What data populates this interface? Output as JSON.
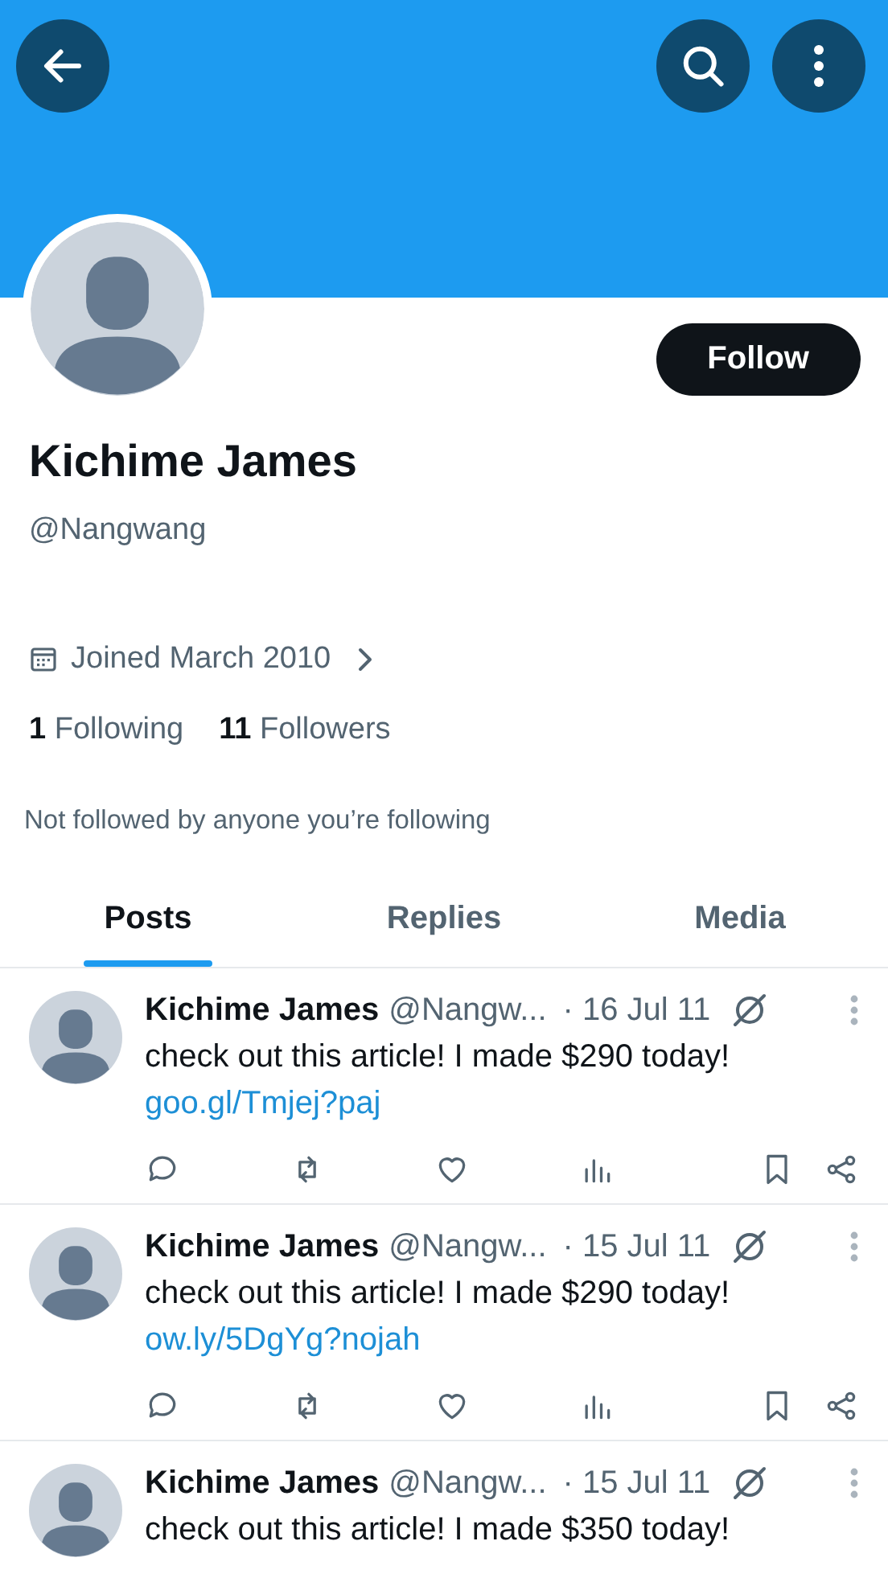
{
  "profile": {
    "name": "Kichime James",
    "handle": "@Nangwang",
    "joined": "Joined March 2010",
    "following_count": "1",
    "following_label": "Following",
    "followers_count": "11",
    "followers_label": "Followers",
    "note": "Not followed by anyone you’re following",
    "follow_button": "Follow"
  },
  "tabs": [
    {
      "label": "Posts",
      "selected": true
    },
    {
      "label": "Replies",
      "selected": false
    },
    {
      "label": "Media",
      "selected": false
    }
  ],
  "posts": [
    {
      "kind": "full",
      "name": "Kichime James",
      "handle": "@Nangw...",
      "date": "· 16 Jul 11",
      "text": "check out this article! I made $290 today!",
      "link": "goo.gl/Tmjej?paj"
    },
    {
      "kind": "full",
      "name": "Kichime James",
      "handle": "@Nangw...",
      "date": "· 15 Jul 11",
      "text": "check out this article! I made $290 today!",
      "link": "ow.ly/5DgYg?nojah"
    },
    {
      "kind": "cut",
      "name": "Kichime James",
      "handle": "@Nangw...",
      "date": "· 15 Jul 11",
      "text": "check out this article! I made $350 today!"
    }
  ]
}
